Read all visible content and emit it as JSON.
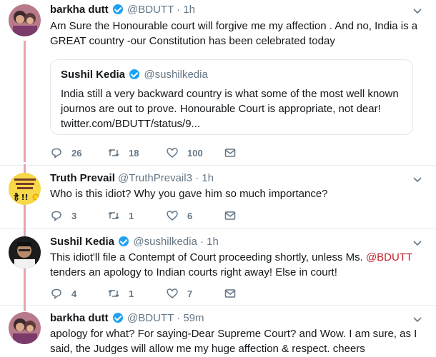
{
  "tweets": [
    {
      "name": "barkha dutt",
      "handle": "@BDUTT",
      "dot": "·",
      "time": "1h",
      "text": "Am Sure the Honourable court will forgive me my affection . And no, India is a GREAT country -our Constitution has been celebrated today",
      "quote": {
        "name": "Sushil Kedia",
        "handle": "@sushilkedia",
        "text": "India still a very backward country is what some of the most well known journos are out to prove. Honourable Court is appropriate, not dear! twitter.com/BDUTT/status/9..."
      },
      "replies": "26",
      "retweets": "18",
      "likes": "100"
    },
    {
      "name": "Truth Prevail",
      "handle": "@TruthPrevail3",
      "dot": "·",
      "time": "1h",
      "text": "Who is this idiot? Why you gave him so much importance?",
      "replies": "3",
      "retweets": "1",
      "likes": "6"
    },
    {
      "name": "Sushil Kedia",
      "handle": "@sushilkedia",
      "dot": "·",
      "time": "1h",
      "text_before": "This idiot'll file a Contempt of Court proceeding shortly, unless Ms.",
      "text_mention": "@BDUTT",
      "text_after": "tenders an apology to Indian courts right away! Else in court!",
      "replies": "4",
      "retweets": "1",
      "likes": "7"
    },
    {
      "name": "barkha dutt",
      "handle": "@BDUTT",
      "dot": "·",
      "time": "59m",
      "text": "apology for what? For saying-Dear Supreme Court? and Wow. I am sure, as I said, the Judges will allow me my huge affection & respect. cheers"
    }
  ],
  "avatar_text": {
    "truth_prevail": "है !!"
  },
  "colors": {
    "thread_line": "#e6a5ad",
    "verified": "#1da1f2",
    "mention": "#c0232c",
    "secondary": "#657786"
  }
}
